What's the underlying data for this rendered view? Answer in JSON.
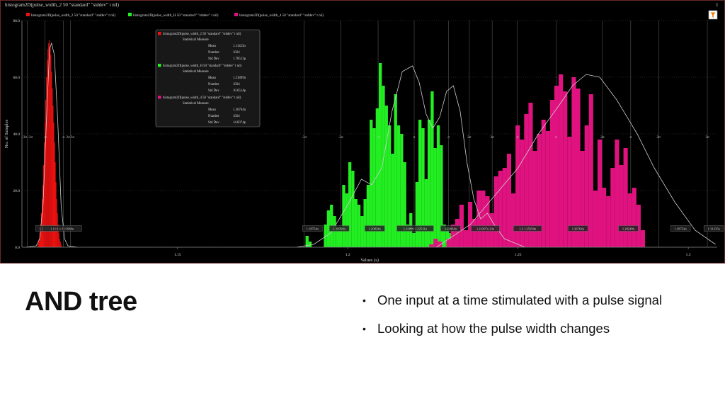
{
  "slide": {
    "title": "AND tree",
    "bullets": [
      "One input at a time stimulated with a pulse signal",
      "Looking at how the pulse width changes"
    ]
  },
  "window": {
    "title": "histogram2D(pulse_width_2 50 \"standard\" \"stddev\" t nil)",
    "corner_label": "1",
    "filter_icon": "filter-funnel-icon"
  },
  "colors": {
    "background": "#000000",
    "red": "#ee1111",
    "green": "#22ee22",
    "magenta": "#e0127f",
    "curve": "#cfcfcf",
    "grid": "#444444",
    "sigma_line": "#bbbbbb"
  },
  "chart_data": {
    "type": "bar",
    "title": "histogram2D(pulse_width_2 50 \"standard\" \"stddev\" t nil)",
    "xlabel": "Values (s)",
    "ylabel": "No. of Samples",
    "xlim": [
      1.1043,
      1.3085
    ],
    "ylim": [
      0,
      80
    ],
    "x_ticks": [
      {
        "value": 1.15,
        "label": "1.15"
      },
      {
        "value": 1.2,
        "label": "1.2"
      },
      {
        "value": 1.25,
        "label": "1.25"
      },
      {
        "value": 1.3,
        "label": "1.3"
      }
    ],
    "y_ticks": [
      {
        "value": 0,
        "label": "0.0"
      },
      {
        "value": 20,
        "label": "20.0"
      },
      {
        "value": 40,
        "label": "40.0"
      },
      {
        "value": 60,
        "label": "60.0"
      },
      {
        "value": 80,
        "label": "80.0"
      }
    ],
    "legend": {
      "placement": "top",
      "entries": [
        {
          "label": "histogram2D(pulse_width_2 50 \"standard\" \"stddev\" t nil)",
          "color": "#ee1111"
        },
        {
          "label": "histogram2D(pulse_width_H 50 \"standard\" \"stddev\" t nil)",
          "color": "#22ee22"
        },
        {
          "label": "histogram2D(pulse_width_4 50 \"standard\" \"stddev\" t nil)",
          "color": "#e0127f"
        }
      ]
    },
    "stats_box": [
      {
        "name": "histogram2D(pulse_width_2 50 \"standard\" \"stddev\" t nil)",
        "color": "#ee1111",
        "heading": "Statistical Measure",
        "rows": [
          {
            "label": "Mean",
            "value": "1.11423n"
          },
          {
            "label": "Number",
            "value": "1024"
          },
          {
            "label": "Std Dev",
            "value": "1.78513p"
          }
        ]
      },
      {
        "name": "histogram2D(pulse_width_H 50 \"standard\" \"stddev\" t nil)",
        "color": "#22ee22",
        "heading": "Statistical Measure",
        "rows": [
          {
            "label": "Mean",
            "value": "1.21899n"
          },
          {
            "label": "Number",
            "value": "1024"
          },
          {
            "label": "Std Dev",
            "value": "10.6514p"
          }
        ]
      },
      {
        "name": "histogram2D(pulse_width_4 50 \"standard\" \"stddev\" t nil)",
        "color": "#e0127f",
        "heading": "Statistical Measure",
        "rows": [
          {
            "label": "Mean",
            "value": "1.26764n"
          },
          {
            "label": "Number",
            "value": "1024"
          },
          {
            "label": "Std Dev",
            "value": "14.8374p"
          }
        ]
      }
    ],
    "sigma_labels": [
      {
        "x": 1.1059,
        "text": "-3σ -2σ"
      },
      {
        "x": 1.1111,
        "text": "-σ"
      },
      {
        "x": 1.1165,
        "text": "σ"
      },
      {
        "x": 1.1185,
        "text": "2σ 3σ"
      },
      {
        "x": 1.1872,
        "text": "-3σ"
      },
      {
        "x": 1.1979,
        "text": "-2σ"
      },
      {
        "x": 1.2089,
        "text": "-σ"
      },
      {
        "x": 1.2195,
        "text": "σ"
      },
      {
        "x": 1.2296,
        "text": "σ"
      },
      {
        "x": 1.2357,
        "text": "2σ"
      },
      {
        "x": 1.2424,
        "text": "2σ"
      },
      {
        "x": 1.2497,
        "text": "-σ"
      },
      {
        "x": 1.2612,
        "text": "σ"
      },
      {
        "x": 1.2748,
        "text": "2σ"
      },
      {
        "x": 1.2831,
        "text": "σ"
      },
      {
        "x": 1.2913,
        "text": "2σ"
      },
      {
        "x": 1.3056,
        "text": "3σ"
      }
    ],
    "marker_labels": [
      {
        "x": 1.1112,
        "text": "1.10888n"
      },
      {
        "x": 1.1161,
        "text": "1.11:1.1:1.11969n"
      },
      {
        "x": 1.1896,
        "text": "1.18754n"
      },
      {
        "x": 1.1975,
        "text": "1.19769n"
      },
      {
        "x": 1.2079,
        "text": "1.20834n"
      },
      {
        "x": 1.2198,
        "text": "1.21899 1.22531n"
      },
      {
        "x": 1.2302,
        "text": "1.22964n"
      },
      {
        "x": 1.2404,
        "text": "1.23297n 23n"
      },
      {
        "x": 1.2528,
        "text": "1.2 1.25250n"
      },
      {
        "x": 1.2676,
        "text": "1.26764n"
      },
      {
        "x": 1.2824,
        "text": "1.28249n"
      },
      {
        "x": 1.2977,
        "text": "1.29732n"
      },
      {
        "x": 1.3075,
        "text": "1.31215n"
      }
    ],
    "series": [
      {
        "name": "histogram2D(pulse_width_2 50 \"standard\" \"stddev\" t nil)",
        "color": "#ee1111",
        "x_start": 1.10884,
        "bin_width": 0.000214,
        "values": [
          1,
          2,
          3,
          5,
          8,
          12,
          17,
          22,
          29,
          37,
          44,
          52,
          60,
          66,
          70,
          72,
          73,
          71,
          68,
          62,
          56,
          50,
          44,
          37,
          30,
          23,
          17,
          12,
          8,
          5,
          3,
          2,
          1
        ]
      },
      {
        "name": "histogram2D(pulse_width_H 50 \"standard\" \"stddev\" t nil)",
        "color": "#22ee22",
        "x_start": 1.1876,
        "bin_width": 0.000896,
        "values": [
          4,
          2,
          0,
          0,
          0,
          0,
          8,
          13,
          15,
          11,
          7,
          7,
          22,
          19,
          30,
          27,
          17,
          15,
          11,
          17,
          22,
          45,
          42,
          49,
          65,
          57,
          50,
          43,
          33,
          54,
          43,
          40,
          30,
          8,
          12,
          5,
          23,
          45,
          42,
          24,
          45,
          55,
          35,
          43,
          36,
          8,
          7,
          5,
          3,
          2
        ]
      },
      {
        "name": "histogram2D(pulse_width_4 50 \"standard\" \"stddev\" t nil)",
        "color": "#e0127f",
        "x_start": 1.2239,
        "bin_width": 0.001268,
        "values": [
          1,
          3,
          2,
          0,
          3,
          8,
          10,
          15,
          6,
          16,
          10,
          20,
          20,
          18,
          12,
          25,
          27,
          28,
          33,
          19,
          43,
          38,
          47,
          51,
          34,
          40,
          45,
          41,
          52,
          57,
          61,
          55,
          39,
          60,
          56,
          34,
          43,
          54,
          20,
          38,
          21,
          18,
          28,
          38,
          29,
          35,
          19,
          21,
          15,
          6
        ]
      }
    ],
    "fit_curves": [
      {
        "series": "pulse_width_2",
        "points": [
          [
            1.1055,
            0
          ],
          [
            1.1085,
            0.5
          ],
          [
            1.1095,
            3
          ],
          [
            1.1105,
            15
          ],
          [
            1.1115,
            45
          ],
          [
            1.1124,
            70
          ],
          [
            1.113,
            72
          ],
          [
            1.1138,
            68
          ],
          [
            1.1148,
            45
          ],
          [
            1.1158,
            15
          ],
          [
            1.1168,
            3
          ],
          [
            1.1178,
            0.5
          ],
          [
            1.1205,
            0
          ]
        ]
      },
      {
        "series": "pulse_width_H",
        "points": [
          [
            1.185,
            0
          ],
          [
            1.19,
            1
          ],
          [
            1.195,
            5
          ],
          [
            1.2,
            15
          ],
          [
            1.204,
            24
          ],
          [
            1.207,
            22
          ],
          [
            1.21,
            28
          ],
          [
            1.213,
            48
          ],
          [
            1.216,
            62
          ],
          [
            1.219,
            64
          ],
          [
            1.221,
            58
          ],
          [
            1.223,
            47
          ],
          [
            1.225,
            42
          ],
          [
            1.227,
            46
          ],
          [
            1.229,
            55
          ],
          [
            1.231,
            57
          ],
          [
            1.233,
            48
          ],
          [
            1.235,
            30
          ],
          [
            1.237,
            17
          ],
          [
            1.239,
            10
          ],
          [
            1.241,
            12
          ],
          [
            1.243,
            8
          ],
          [
            1.246,
            3
          ],
          [
            1.252,
            0
          ]
        ]
      },
      {
        "series": "pulse_width_4",
        "points": [
          [
            1.226,
            0
          ],
          [
            1.236,
            8
          ],
          [
            1.243,
            18
          ],
          [
            1.25,
            28
          ],
          [
            1.256,
            40
          ],
          [
            1.262,
            50
          ],
          [
            1.266,
            57
          ],
          [
            1.27,
            61
          ],
          [
            1.274,
            60
          ],
          [
            1.279,
            52
          ],
          [
            1.285,
            40
          ],
          [
            1.29,
            28
          ],
          [
            1.296,
            16
          ],
          [
            1.302,
            6
          ],
          [
            1.308,
            1
          ]
        ]
      }
    ]
  }
}
